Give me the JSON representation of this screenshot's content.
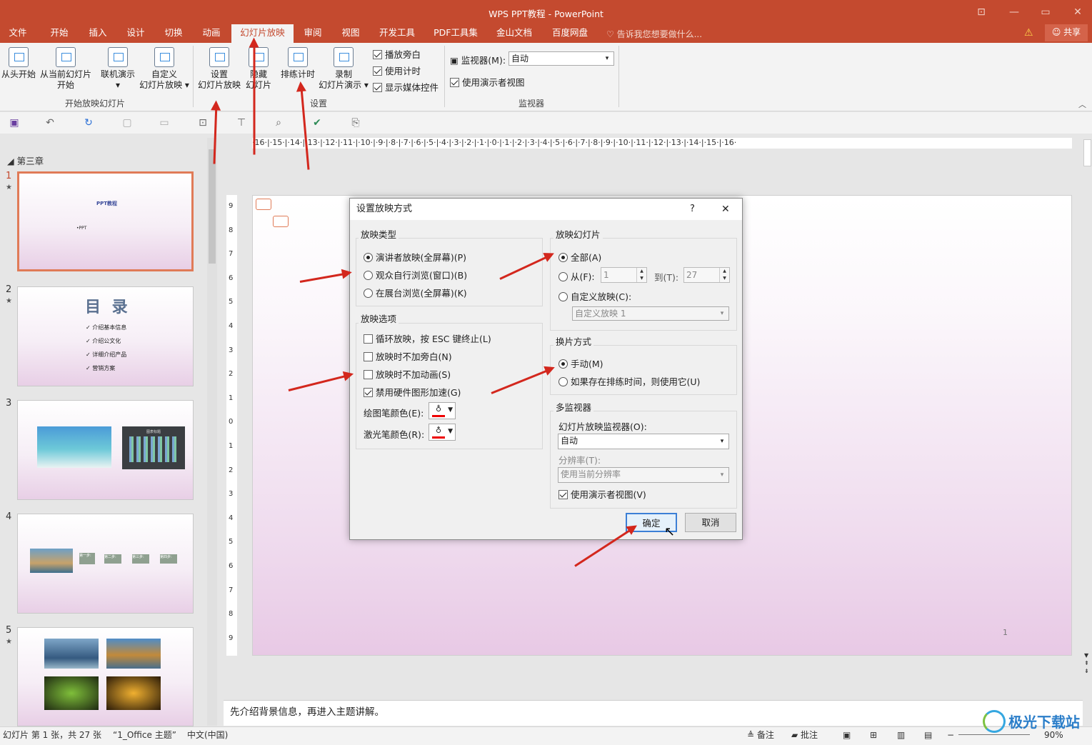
{
  "window": {
    "title": "WPS PPT教程 - PowerPoint",
    "minimize": "—",
    "restore": "▭",
    "close": "✕"
  },
  "tabs": [
    "文件",
    "开始",
    "插入",
    "设计",
    "切换",
    "动画",
    "幻灯片放映",
    "审阅",
    "视图",
    "开发工具",
    "PDF工具集",
    "金山文档",
    "百度网盘"
  ],
  "active_tab": "幻灯片放映",
  "tell_me": "告诉我您想要做什么...",
  "share": "共享",
  "ribbon": {
    "start_group": {
      "label": "开始放映幻灯片",
      "from_start": "从头开始",
      "from_current_1": "从当前幻灯片",
      "from_current_2": "开始",
      "online_1": "联机演示",
      "online_2": "▾",
      "custom_1": "自定义",
      "custom_2": "幻灯片放映 ▾"
    },
    "setup_group": {
      "label": "设置",
      "setup_1": "设置",
      "setup_2": "幻灯片放映",
      "hide_1": "隐藏",
      "hide_2": "幻灯片",
      "rehearse": "排练计时",
      "record_1": "录制",
      "record_2": "幻灯片演示 ▾",
      "play_narration": "播放旁白",
      "use_timings": "使用计时",
      "show_media_controls": "显示媒体控件"
    },
    "monitors_group": {
      "label": "监视器",
      "monitor_label": "监视器(M):",
      "monitor_value": "自动",
      "presenter_view": "使用演示者视图"
    }
  },
  "section": "第三章",
  "slides": [
    {
      "num": "1",
      "star": "★",
      "title": "PPT教程",
      "sub": "•PPT"
    },
    {
      "num": "2",
      "star": "★",
      "title": "目 录",
      "items": [
        "✓ 介绍基本信息",
        "✓ 介绍公文化",
        "✓ 详细介绍产品",
        "✓ 营销方案"
      ]
    },
    {
      "num": "3",
      "star": "",
      "chart_title": "图表标题"
    },
    {
      "num": "4",
      "star": "",
      "steps": [
        "第一步:",
        "第二步:",
        "第三步:",
        "第四步:"
      ]
    },
    {
      "num": "5",
      "star": "★"
    }
  ],
  "ruler_h": "·16·|·15·|·14·|·13·|·12·|·11·|·10·|·9·|·8·|·7·|·6·|·5·|·4·|·3·|·2·|·1·|·0·|·1·|·2·|·3·|·4·|·5·|·6·|·7·|·8·|·9·|·10·|·11·|·12·|·13·|·14·|·15·|·16·",
  "ruler_v_labels": [
    "9",
    "8",
    "7",
    "6",
    "5",
    "4",
    "3",
    "2",
    "1",
    "0",
    "1",
    "2",
    "3",
    "4",
    "5",
    "6",
    "7",
    "8",
    "9"
  ],
  "slide_page_number": "1",
  "notes": "先介绍背景信息，再进入主题讲解。",
  "status": {
    "slide_info": "幻灯片 第 1 张，共 27 张",
    "theme": "“1_Office 主题”",
    "language": "中文(中国)",
    "notes": "备注",
    "comments": "批注",
    "zoom": "90%"
  },
  "watermark": "极光下载站",
  "dialog": {
    "title": "设置放映方式",
    "help": "?",
    "close": "✕",
    "show_type": {
      "label": "放映类型",
      "options": [
        "演讲者放映(全屏幕)(P)",
        "观众自行浏览(窗口)(B)",
        "在展台浏览(全屏幕)(K)"
      ],
      "selected": 0
    },
    "show_options": {
      "label": "放映选项",
      "items": [
        {
          "text": "循环放映，按 ESC 键终止(L)",
          "checked": false
        },
        {
          "text": "放映时不加旁白(N)",
          "checked": false
        },
        {
          "text": "放映时不加动画(S)",
          "checked": false
        },
        {
          "text": "禁用硬件图形加速(G)",
          "checked": true
        }
      ],
      "pen_color": "绘图笔颜色(E):",
      "laser_color": "激光笔颜色(R):"
    },
    "show_slides": {
      "label": "放映幻灯片",
      "all": "全部(A)",
      "from": "从(F):",
      "from_value": "1",
      "to": "到(T):",
      "to_value": "27",
      "custom": "自定义放映(C):",
      "custom_value": "自定义放映 1"
    },
    "advance": {
      "label": "换片方式",
      "manual": "手动(M)",
      "timings": "如果存在排练时间，则使用它(U)"
    },
    "multi_monitor": {
      "label": "多监视器",
      "monitor_label": "幻灯片放映监视器(O):",
      "monitor_value": "自动",
      "resolution_label": "分辨率(T):",
      "resolution_value": "使用当前分辨率",
      "presenter_view": "使用演示者视图(V)"
    },
    "ok": "确定",
    "cancel": "取消"
  },
  "colors": {
    "accent": "#c44a2f",
    "arrow": "#d3271d",
    "selection": "#e07b57"
  }
}
